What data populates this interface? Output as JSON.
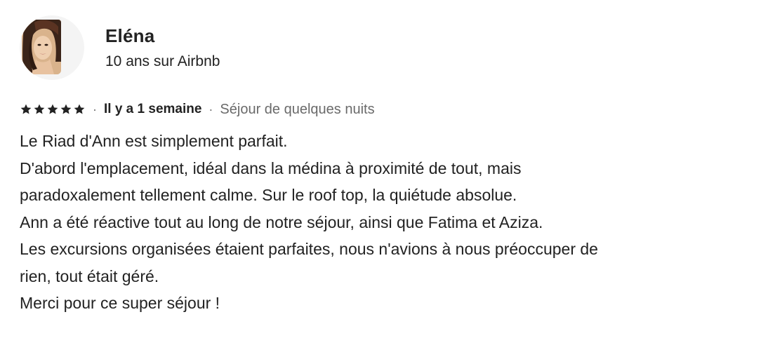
{
  "reviewer": {
    "name": "Eléna",
    "tenure": "10 ans sur Airbnb"
  },
  "review": {
    "rating": 5,
    "date": "Il y a 1 semaine",
    "stay_type": "Séjour de quelques nuits",
    "separator": "·",
    "lines": [
      "Le Riad d'Ann est simplement parfait.",
      "D'abord l'emplacement, idéal dans la médina à proximité de tout, mais",
      "paradoxalement tellement calme. Sur le roof top, la quiétude absolue.",
      "Ann a été réactive tout au long de notre séjour, ainsi que Fatima et Aziza.",
      "Les excursions organisées étaient parfaites, nous n'avions à nous préoccuper de",
      "rien, tout était géré.",
      "Merci pour ce super séjour !"
    ]
  },
  "icons": {
    "star": "star-icon"
  },
  "colors": {
    "text": "#222222",
    "secondary_text": "#6a6a6a",
    "star": "#222222"
  }
}
